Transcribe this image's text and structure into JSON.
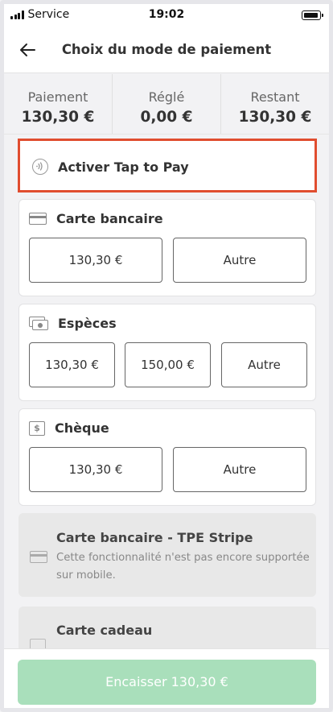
{
  "status_bar": {
    "carrier": "Service",
    "time": "19:02"
  },
  "header": {
    "title": "Choix du mode de paiement"
  },
  "summary": [
    {
      "label": "Paiement",
      "value": "130,30 €"
    },
    {
      "label": "Réglé",
      "value": "0,00 €"
    },
    {
      "label": "Restant",
      "value": "130,30 €"
    }
  ],
  "tap_to_pay": {
    "label": "Activer Tap to Pay"
  },
  "methods": {
    "card": {
      "title": "Carte bancaire",
      "buttons": [
        "130,30 €",
        "Autre"
      ]
    },
    "cash": {
      "title": "Espèces",
      "buttons": [
        "130,30 €",
        "150,00 €",
        "Autre"
      ]
    },
    "check": {
      "title": "Chèque",
      "icon_glyph": "$",
      "buttons": [
        "130,30 €",
        "Autre"
      ]
    },
    "stripe": {
      "title": "Carte bancaire - TPE Stripe",
      "description": "Cette fonctionnalité n'est pas encore supportée sur mobile."
    },
    "gift": {
      "title": "Carte cadeau"
    }
  },
  "footer": {
    "button_label": "Encaisser 130,30 €"
  },
  "colors": {
    "highlight": "#e04d2f",
    "primary_disabled": "#a9dfbb"
  }
}
